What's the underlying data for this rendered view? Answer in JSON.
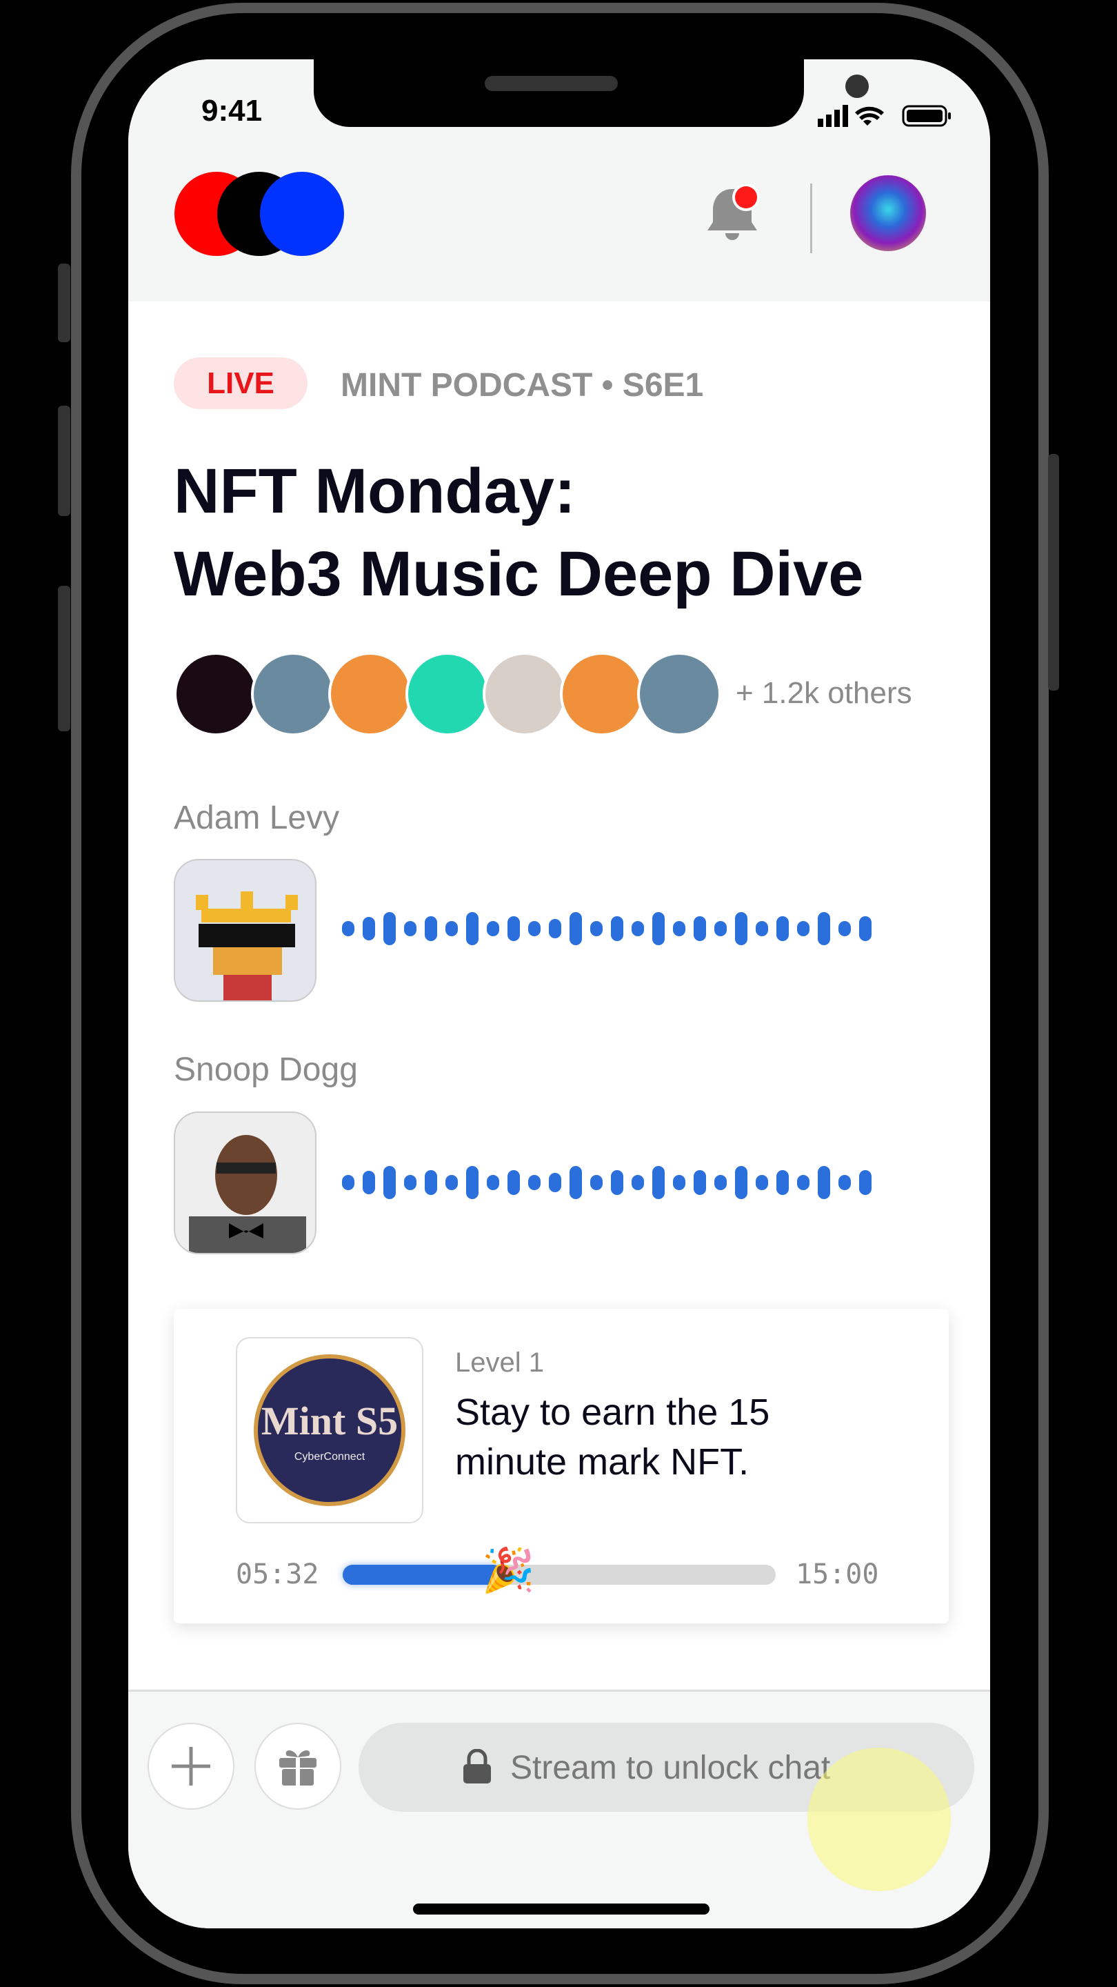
{
  "status_bar": {
    "time": "9:41"
  },
  "header": {
    "logo_colors": [
      "#ff0000",
      "#000000",
      "#0033ff"
    ],
    "notification_dot_color": "#ff1a1a"
  },
  "episode": {
    "live_label": "LIVE",
    "show": "MINT PODCAST • S6E1",
    "title_line1": "NFT Monday:",
    "title_line2": "Web3 Music Deep Dive",
    "listeners_more": "+ 1.2k others"
  },
  "speakers": [
    {
      "name": "Adam Levy"
    },
    {
      "name": "Snoop Dogg"
    }
  ],
  "reward_card": {
    "level": "Level 1",
    "text": "Stay to earn the 15 minute mark NFT.",
    "nft_title": "Mint S5",
    "nft_partner": "CyberConnect",
    "elapsed": "05:32",
    "total": "15:00",
    "progress": 0.369,
    "progress_icon": "party-popper"
  },
  "bottom_bar": {
    "chat_placeholder": "Stream to unlock chat"
  },
  "colors": {
    "accent": "#2b6fdc",
    "live": "#e8151b",
    "live_bg": "#fde3e3"
  }
}
